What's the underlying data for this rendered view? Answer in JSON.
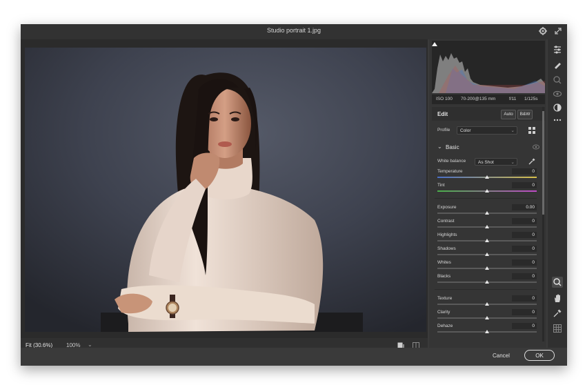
{
  "window": {
    "title": "Studio portrait 1.jpg"
  },
  "histogram": {
    "exif": {
      "iso": "ISO 100",
      "lens": "70-200@135 mm",
      "aperture": "f/11",
      "shutter": "1/125s"
    }
  },
  "edit": {
    "title": "Edit",
    "auto_label": "Auto",
    "bw_label": "B&W",
    "profile_label": "Profile",
    "profile_value": "Color",
    "section_label": "Basic",
    "wb_label": "White balance",
    "wb_value": "As Shot"
  },
  "sliders": [
    {
      "label": "Temperature",
      "value": "0",
      "level": 0.5
    },
    {
      "label": "Tint",
      "value": "0",
      "level": 0.5
    },
    {
      "label": "Exposure",
      "value": "0.00",
      "level": 0.5
    },
    {
      "label": "Contrast",
      "value": "0",
      "level": 0.5
    },
    {
      "label": "Highlights",
      "value": "0",
      "level": 0.5
    },
    {
      "label": "Shadows",
      "value": "0",
      "level": 0.5
    },
    {
      "label": "Whites",
      "value": "0",
      "level": 0.5
    },
    {
      "label": "Blacks",
      "value": "0",
      "level": 0.5
    },
    {
      "label": "Texture",
      "value": "0",
      "level": 0.5
    },
    {
      "label": "Clarity",
      "value": "0",
      "level": 0.5
    },
    {
      "label": "Dehaze",
      "value": "0",
      "level": 0.5
    }
  ],
  "zoom": {
    "fit_label": "Fit (30.6%)",
    "percent_label": "100%",
    "dropdown_glyph": "⌄"
  },
  "footer": {
    "cancel_label": "Cancel",
    "ok_label": "OK"
  },
  "colors": {
    "window_bg": "#3a3a3a",
    "backdrop": "#3d414d",
    "sweater": "#eadbd0"
  },
  "icons": [
    "gear-icon",
    "expand-icon",
    "edit-sliders-icon",
    "brush-icon",
    "heal-icon",
    "red-eye-icon",
    "masking-icon",
    "more-icon",
    "zoom-icon",
    "hand-icon",
    "color-sampler-icon",
    "grid-overlay-icon"
  ]
}
